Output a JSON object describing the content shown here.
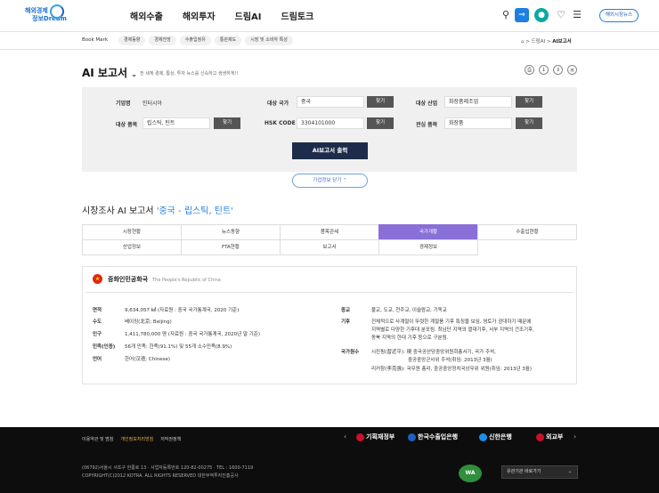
{
  "header": {
    "logo_line1": "해외경제",
    "logo_line2": "정보Dream",
    "nav": [
      "해외수출",
      "해외투자",
      "드림AI",
      "드림토크"
    ],
    "news_button": "해외시장뉴스"
  },
  "bookmark": {
    "label": "Book Mark",
    "chips": [
      "경제동향",
      "경제전망",
      "수출입정유",
      "통관제도",
      "시장 및 소비자 특성"
    ],
    "breadcrumb_mid": "드림AI",
    "breadcrumb_current": "AI보고서"
  },
  "page": {
    "title": "AI 보고서",
    "description": "전 세계 경제, 통상, 투자 뉴스를 신속하고 생생하게!!"
  },
  "form": {
    "company_label": "기업명",
    "company_value": "인터시아",
    "country_label": "대상 국가",
    "country_value": "중국",
    "industry_label": "대상 산업",
    "industry_value": "화장품제조업",
    "product_label": "대상 품목",
    "product_value": "립스틱, 틴트",
    "hs_label": "HSK CODE",
    "hs_value": "3304101000",
    "interest_label": "관심 품목",
    "interest_value": "화장품",
    "find": "찾기",
    "run_button": "AI보고서 출력",
    "toggle_button": "기업정보 닫기"
  },
  "section": {
    "title_prefix": "시장조사 AI 보고서 ",
    "title_highlight": "'중국 - 립스틱, 틴트'"
  },
  "tabs": [
    "시장현황",
    "뉴스동향",
    "품목관세",
    "국가개황",
    "수출입현황",
    "산업정보",
    "FTA현황",
    "보고서",
    "경제정보"
  ],
  "active_tab": "국가개황",
  "country": {
    "name_ko": "중화인민공화국",
    "name_en": "The People's Republic of China",
    "left": [
      {
        "k": "면적",
        "v": "9,634,057 ㎢ (자료원 : 중국 국가통계국, 2020 기준)"
      },
      {
        "k": "수도",
        "v": "베이징(北京; Beijing)"
      },
      {
        "k": "인구",
        "v": "1,411,780,000 명 (자료원 : 중국 국가통계국, 2020년 말 기준)"
      },
      {
        "k": "민족(인종)",
        "v": "56개 민족: 한족(91.1%) 및 55개 소수민족(8.9%)"
      },
      {
        "k": "언어",
        "v": "한어(汉语; Chinese)"
      }
    ],
    "religion_label": "종교",
    "religion_value": "불교, 도교, 천주교, 이슬람교, 기독교",
    "climate_label": "기후",
    "climate_lines": [
      "전체적으로 사계절이 뚜렷한 계절풍 기후 특징을 보임. 영토가 광대하기 때문에",
      "지역별로 다양한 기후대 분포됨. 최남단 지역의 열대기후, 서부 지역의 건조기후,",
      "동북 지역의 한대 기후 등으로 구분됨."
    ],
    "leader_label": "국가원수",
    "leader_lines": [
      "시진핑(習近平): 現 중국공산당중앙위원회총서기, 국가 주석,",
      "중공중앙군사위 주석(취임: 2013년 3월)",
      "리커창(李克强): 국무원 총리, 중공중앙정치국상무위 위원(취임: 2013년 3월)"
    ]
  },
  "footer": {
    "links": [
      "이용약관 및 범침",
      "개인정보처리방침",
      "저작권정책"
    ],
    "partners": [
      "기획재정부",
      "한국수출입은행",
      "신한은행",
      "외교부"
    ],
    "address": "(06792)서울시 서초구 헌릉로 13  ·  사업자등록번호 120-82-00275  ·  TEL : 1600-7119",
    "copyright": "COPYRIGHT(C)2012 KOTRA. ALL RIGHTS RESERVED 대한무역투자진흥공사",
    "wa_mark": "WA",
    "related_select": "유관기관 바로가기"
  },
  "colors": {
    "active_tab": "#8a6fd8",
    "run_button": "#1d2c4a",
    "highlight": "#2a7fd8",
    "footer_bg": "#0d0d0d"
  }
}
